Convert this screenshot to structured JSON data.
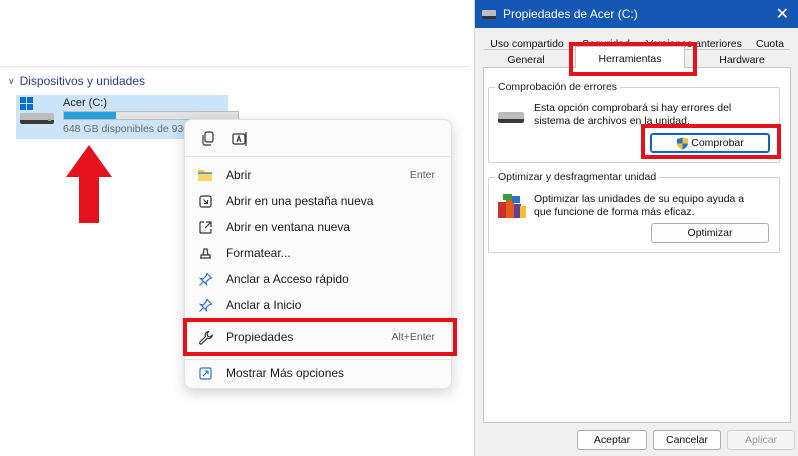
{
  "explorer": {
    "section_title": "Dispositivos y unidades",
    "drive": {
      "name": "Acer (C:)",
      "free_space_text": "648 GB disponibles de 930 GB",
      "usage_fraction": 0.3
    }
  },
  "context_menu": {
    "quick_actions": [
      {
        "icon": "copy-icon"
      },
      {
        "icon": "rename-icon"
      }
    ],
    "items": [
      {
        "label": "Abrir",
        "shortcut": "Enter",
        "icon": "folder-icon"
      },
      {
        "label": "Abrir en una pestaña nueva",
        "shortcut": "",
        "icon": "new-tab-icon"
      },
      {
        "label": "Abrir en ventana nueva",
        "shortcut": "",
        "icon": "open-window-icon"
      },
      {
        "label": "Formatear...",
        "shortcut": "",
        "icon": "format-icon"
      },
      {
        "label": "Anclar a Acceso rápido",
        "shortcut": "",
        "icon": "pin-icon"
      },
      {
        "label": "Anclar a Inicio",
        "shortcut": "",
        "icon": "pin-icon"
      },
      {
        "label": "Propiedades",
        "shortcut": "Alt+Enter",
        "icon": "wrench-icon"
      }
    ],
    "more_options": {
      "label": "Mostrar Más opciones",
      "icon": "more-options-icon"
    }
  },
  "dialog": {
    "title": "Propiedades de Acer (C:)",
    "tabs_back": [
      "Uso compartido",
      "Seguridad",
      "Versiones anteriores",
      "Cuota"
    ],
    "tabs_front": [
      "General",
      "Herramientas",
      "Hardware"
    ],
    "active_tab": "Herramientas",
    "error_check": {
      "legend": "Comprobación de errores",
      "description": "Esta opción comprobará si hay errores del sistema de archivos en la unidad.",
      "button": "Comprobar"
    },
    "optimize": {
      "legend": "Optimizar y desfragmentar unidad",
      "description": "Optimizar las unidades de su equipo ayuda a que funcione de forma más eficaz.",
      "button": "Optimizar"
    },
    "footer": {
      "ok": "Aceptar",
      "cancel": "Cancelar",
      "apply": "Aplicar"
    }
  },
  "colors": {
    "highlight": "#e3121c",
    "title_bar": "#1558b3",
    "usage_bar": "#26a0da"
  }
}
